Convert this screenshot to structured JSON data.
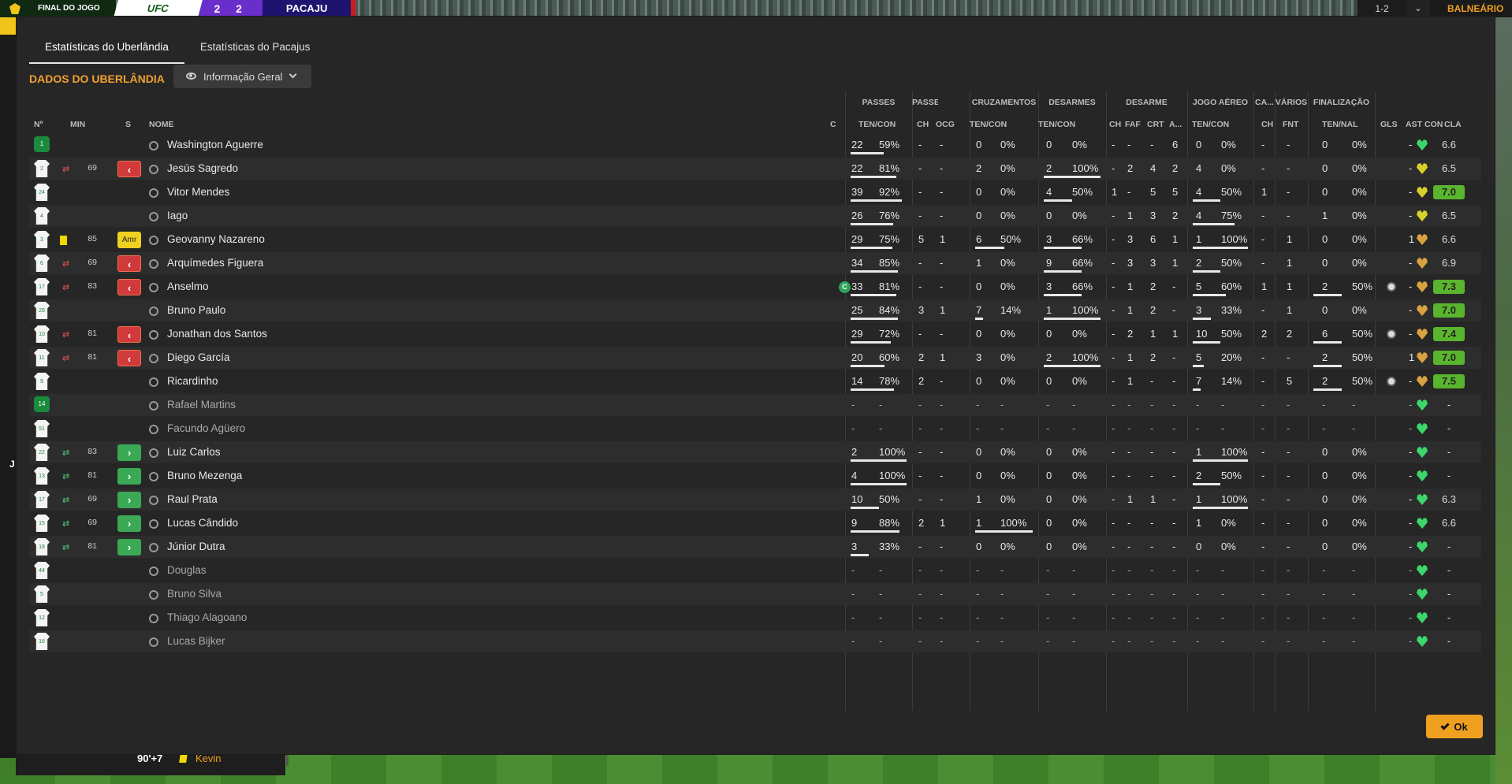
{
  "topbar": {
    "state": "FINAL DO JOGO",
    "home": "UFC",
    "score": "2 2",
    "away": "PACAJU",
    "period": "1-2",
    "dressing": "BALNEÁRIO"
  },
  "left_letter": "J",
  "event": {
    "minute": "90'+7",
    "player": "Kevin"
  },
  "tabs": [
    "Estatísticas do Uberlândia",
    "Estatísticas do Pacajus"
  ],
  "section_title": "DADOS DO UBERLÂNDIA",
  "view_select": "Informação Geral",
  "groups": [
    "PASSES",
    "PASSE",
    "CRUZAMENTOS",
    "DESARMES",
    "DESARME",
    "JOGO AÉREO",
    "CA...",
    "VÁRIOS",
    "FINALIZAÇÃO"
  ],
  "headers": [
    "Nº",
    "MIN",
    "S",
    "NOME",
    "C",
    "TEN/CON",
    "CH",
    "OCG",
    "TEN/CON",
    "TEN/CON",
    "CH",
    "FAF",
    "CRT",
    "A...",
    "TEN/CON",
    "CH",
    "FNT",
    "TEN/NAL",
    "GLS",
    "AST",
    "CON",
    "CLA"
  ],
  "players": [
    {
      "no": "1",
      "gk": true,
      "name": "Washington Aguerre",
      "pas": [
        "22",
        "59%"
      ],
      "pch": "-",
      "pocg": "-",
      "cr": [
        "0",
        "0%"
      ],
      "ds": [
        "0",
        "0%"
      ],
      "dc": "-",
      "faf": "-",
      "crt": "-",
      "a": "6",
      "aer": [
        "0",
        "0%"
      ],
      "cach": "-",
      "fnt": "-",
      "fin": [
        "0",
        "0%"
      ],
      "gls": "",
      "ast": "-",
      "con": "green",
      "cla": "6.6",
      "hi": false
    },
    {
      "no": "2",
      "min": "69",
      "sub": "out",
      "name": "Jesús Sagredo",
      "pas": [
        "22",
        "81%"
      ],
      "pch": "-",
      "pocg": "-",
      "cr": [
        "2",
        "0%"
      ],
      "ds": [
        "2",
        "100%"
      ],
      "dc": "-",
      "faf": "2",
      "crt": "4",
      "a": "2",
      "aer": [
        "4",
        "0%"
      ],
      "cach": "-",
      "fnt": "-",
      "fin": [
        "0",
        "0%"
      ],
      "gls": "",
      "ast": "-",
      "con": "yellow",
      "cla": "6.5",
      "hi": false
    },
    {
      "no": "24",
      "name": "Vitor Mendes",
      "pas": [
        "39",
        "92%"
      ],
      "pch": "-",
      "pocg": "-",
      "cr": [
        "0",
        "0%"
      ],
      "ds": [
        "4",
        "50%"
      ],
      "dc": "1",
      "faf": "-",
      "crt": "5",
      "a": "5",
      "aer": [
        "4",
        "50%"
      ],
      "cach": "1",
      "fnt": "-",
      "fin": [
        "0",
        "0%"
      ],
      "gls": "",
      "ast": "-",
      "con": "yellow",
      "cla": "7.0",
      "hi": true
    },
    {
      "no": "4",
      "name": "Iago",
      "pas": [
        "26",
        "76%"
      ],
      "pch": "-",
      "pocg": "-",
      "cr": [
        "0",
        "0%"
      ],
      "ds": [
        "0",
        "0%"
      ],
      "dc": "-",
      "faf": "1",
      "crt": "3",
      "a": "2",
      "aer": [
        "4",
        "75%"
      ],
      "cach": "-",
      "fnt": "-",
      "fin": [
        "1",
        "0%"
      ],
      "gls": "",
      "ast": "-",
      "con": "yellow",
      "cla": "6.5",
      "hi": false
    },
    {
      "no": "3",
      "min": "85",
      "sub": "amr",
      "subtext": "Amr",
      "yellow": true,
      "name": "Geovanny Nazareno",
      "pas": [
        "29",
        "75%"
      ],
      "pch": "5",
      "pocg": "1",
      "cr": [
        "6",
        "50%"
      ],
      "ds": [
        "3",
        "66%"
      ],
      "dc": "-",
      "faf": "3",
      "crt": "6",
      "a": "1",
      "aer": [
        "1",
        "100%"
      ],
      "cach": "-",
      "fnt": "1",
      "fin": [
        "0",
        "0%"
      ],
      "gls": "",
      "ast": "1",
      "con": "orange",
      "cla": "6.6",
      "hi": false
    },
    {
      "no": "6",
      "min": "69",
      "sub": "out",
      "name": "Arquímedes Figuera",
      "pas": [
        "34",
        "85%"
      ],
      "pch": "-",
      "pocg": "-",
      "cr": [
        "1",
        "0%"
      ],
      "ds": [
        "9",
        "66%"
      ],
      "dc": "-",
      "faf": "3",
      "crt": "3",
      "a": "1",
      "aer": [
        "2",
        "50%"
      ],
      "cach": "-",
      "fnt": "1",
      "fin": [
        "0",
        "0%"
      ],
      "gls": "",
      "ast": "-",
      "con": "orange",
      "cla": "6.9",
      "hi": false
    },
    {
      "no": "17",
      "min": "83",
      "sub": "out",
      "captain": true,
      "name": "Anselmo",
      "pas": [
        "33",
        "81%"
      ],
      "pch": "-",
      "pocg": "-",
      "cr": [
        "0",
        "0%"
      ],
      "ds": [
        "3",
        "66%"
      ],
      "dc": "-",
      "faf": "1",
      "crt": "2",
      "a": "-",
      "aer": [
        "5",
        "60%"
      ],
      "cach": "1",
      "fnt": "1",
      "fin": [
        "2",
        "50%"
      ],
      "gls": "ball",
      "ast": "-",
      "con": "orange",
      "cla": "7.3",
      "hi": true
    },
    {
      "no": "29",
      "name": "Bruno Paulo",
      "pas": [
        "25",
        "84%"
      ],
      "pch": "3",
      "pocg": "1",
      "cr": [
        "7",
        "14%"
      ],
      "ds": [
        "1",
        "100%"
      ],
      "dc": "-",
      "faf": "1",
      "crt": "2",
      "a": "-",
      "aer": [
        "3",
        "33%"
      ],
      "cach": "-",
      "fnt": "1",
      "fin": [
        "0",
        "0%"
      ],
      "gls": "",
      "ast": "-",
      "con": "orange",
      "cla": "7.0",
      "hi": true
    },
    {
      "no": "10",
      "min": "81",
      "sub": "out",
      "name": "Jonathan dos Santos",
      "pas": [
        "29",
        "72%"
      ],
      "pch": "-",
      "pocg": "-",
      "cr": [
        "0",
        "0%"
      ],
      "ds": [
        "0",
        "0%"
      ],
      "dc": "-",
      "faf": "2",
      "crt": "1",
      "a": "1",
      "aer": [
        "10",
        "50%"
      ],
      "cach": "2",
      "fnt": "2",
      "fin": [
        "6",
        "50%"
      ],
      "gls": "ball",
      "ast": "-",
      "con": "orange",
      "cla": "7.4",
      "hi": true
    },
    {
      "no": "11",
      "min": "81",
      "sub": "out",
      "name": "Diego García",
      "pas": [
        "20",
        "60%"
      ],
      "pch": "2",
      "pocg": "1",
      "cr": [
        "3",
        "0%"
      ],
      "ds": [
        "2",
        "100%"
      ],
      "dc": "-",
      "faf": "1",
      "crt": "2",
      "a": "-",
      "aer": [
        "5",
        "20%"
      ],
      "cach": "-",
      "fnt": "-",
      "fin": [
        "2",
        "50%"
      ],
      "gls": "",
      "ast": "1",
      "con": "orange",
      "cla": "7.0",
      "hi": true
    },
    {
      "no": "9",
      "name": "Ricardinho",
      "pas": [
        "14",
        "78%"
      ],
      "pch": "2",
      "pocg": "-",
      "cr": [
        "0",
        "0%"
      ],
      "ds": [
        "0",
        "0%"
      ],
      "dc": "-",
      "faf": "1",
      "crt": "-",
      "a": "-",
      "aer": [
        "7",
        "14%"
      ],
      "cach": "-",
      "fnt": "5",
      "fin": [
        "2",
        "50%"
      ],
      "gls": "ball",
      "ast": "-",
      "con": "orange",
      "cla": "7.5",
      "hi": true
    },
    {
      "no": "14",
      "gk": true,
      "dim": true,
      "name": "Rafael Martins",
      "pas": [
        "-",
        "-"
      ],
      "pch": "-",
      "pocg": "-",
      "cr": [
        "-",
        "-"
      ],
      "ds": [
        "-",
        "-"
      ],
      "dc": "-",
      "faf": "-",
      "crt": "-",
      "a": "-",
      "aer": [
        "-",
        "-"
      ],
      "cach": "-",
      "fnt": "-",
      "fin": [
        "-",
        "-"
      ],
      "gls": "",
      "ast": "-",
      "con": "green",
      "cla": "-",
      "hi": false
    },
    {
      "no": "51",
      "dim": true,
      "name": "Facundo Agüero",
      "pas": [
        "-",
        "-"
      ],
      "pch": "-",
      "pocg": "-",
      "cr": [
        "-",
        "-"
      ],
      "ds": [
        "-",
        "-"
      ],
      "dc": "-",
      "faf": "-",
      "crt": "-",
      "a": "-",
      "aer": [
        "-",
        "-"
      ],
      "cach": "-",
      "fnt": "-",
      "fin": [
        "-",
        "-"
      ],
      "gls": "",
      "ast": "-",
      "con": "green",
      "cla": "-",
      "hi": false
    },
    {
      "no": "22",
      "min": "83",
      "sub": "in",
      "name": "Luiz Carlos",
      "pas": [
        "2",
        "100%"
      ],
      "pch": "-",
      "pocg": "-",
      "cr": [
        "0",
        "0%"
      ],
      "ds": [
        "0",
        "0%"
      ],
      "dc": "-",
      "faf": "-",
      "crt": "-",
      "a": "-",
      "aer": [
        "1",
        "100%"
      ],
      "cach": "-",
      "fnt": "-",
      "fin": [
        "0",
        "0%"
      ],
      "gls": "",
      "ast": "-",
      "con": "green",
      "cla": "-",
      "hi": false
    },
    {
      "no": "13",
      "min": "81",
      "sub": "in",
      "name": "Bruno Mezenga",
      "pas": [
        "4",
        "100%"
      ],
      "pch": "-",
      "pocg": "-",
      "cr": [
        "0",
        "0%"
      ],
      "ds": [
        "0",
        "0%"
      ],
      "dc": "-",
      "faf": "-",
      "crt": "-",
      "a": "-",
      "aer": [
        "2",
        "50%"
      ],
      "cach": "-",
      "fnt": "-",
      "fin": [
        "0",
        "0%"
      ],
      "gls": "",
      "ast": "-",
      "con": "green",
      "cla": "-",
      "hi": false
    },
    {
      "no": "17",
      "min": "69",
      "sub": "in",
      "name": "Raul Prata",
      "pas": [
        "10",
        "50%"
      ],
      "pch": "-",
      "pocg": "-",
      "cr": [
        "1",
        "0%"
      ],
      "ds": [
        "0",
        "0%"
      ],
      "dc": "-",
      "faf": "1",
      "crt": "1",
      "a": "-",
      "aer": [
        "1",
        "100%"
      ],
      "cach": "-",
      "fnt": "-",
      "fin": [
        "0",
        "0%"
      ],
      "gls": "",
      "ast": "-",
      "con": "green",
      "cla": "6.3",
      "hi": false
    },
    {
      "no": "15",
      "min": "69",
      "sub": "in",
      "name": "Lucas Cândido",
      "pas": [
        "9",
        "88%"
      ],
      "pch": "2",
      "pocg": "1",
      "cr": [
        "1",
        "100%"
      ],
      "ds": [
        "0",
        "0%"
      ],
      "dc": "-",
      "faf": "-",
      "crt": "-",
      "a": "-",
      "aer": [
        "1",
        "0%"
      ],
      "cach": "-",
      "fnt": "-",
      "fin": [
        "0",
        "0%"
      ],
      "gls": "",
      "ast": "-",
      "con": "green",
      "cla": "6.6",
      "hi": false
    },
    {
      "no": "18",
      "min": "81",
      "sub": "in",
      "name": "Júnior Dutra",
      "pas": [
        "3",
        "33%"
      ],
      "pch": "-",
      "pocg": "-",
      "cr": [
        "0",
        "0%"
      ],
      "ds": [
        "0",
        "0%"
      ],
      "dc": "-",
      "faf": "-",
      "crt": "-",
      "a": "-",
      "aer": [
        "0",
        "0%"
      ],
      "cach": "-",
      "fnt": "-",
      "fin": [
        "0",
        "0%"
      ],
      "gls": "",
      "ast": "-",
      "con": "green",
      "cla": "-",
      "hi": false
    },
    {
      "no": "44",
      "dim": true,
      "name": "Douglas",
      "pas": [
        "-",
        "-"
      ],
      "pch": "-",
      "pocg": "-",
      "cr": [
        "-",
        "-"
      ],
      "ds": [
        "-",
        "-"
      ],
      "dc": "-",
      "faf": "-",
      "crt": "-",
      "a": "-",
      "aer": [
        "-",
        "-"
      ],
      "cach": "-",
      "fnt": "-",
      "fin": [
        "-",
        "-"
      ],
      "gls": "",
      "ast": "-",
      "con": "green",
      "cla": "-",
      "hi": false
    },
    {
      "no": "5",
      "dim": true,
      "name": "Bruno Silva",
      "pas": [
        "-",
        "-"
      ],
      "pch": "-",
      "pocg": "-",
      "cr": [
        "-",
        "-"
      ],
      "ds": [
        "-",
        "-"
      ],
      "dc": "-",
      "faf": "-",
      "crt": "-",
      "a": "-",
      "aer": [
        "-",
        "-"
      ],
      "cach": "-",
      "fnt": "-",
      "fin": [
        "-",
        "-"
      ],
      "gls": "",
      "ast": "-",
      "con": "green",
      "cla": "-",
      "hi": false
    },
    {
      "no": "12",
      "dim": true,
      "name": "Thiago Alagoano",
      "pas": [
        "-",
        "-"
      ],
      "pch": "-",
      "pocg": "-",
      "cr": [
        "-",
        "-"
      ],
      "ds": [
        "-",
        "-"
      ],
      "dc": "-",
      "faf": "-",
      "crt": "-",
      "a": "-",
      "aer": [
        "-",
        "-"
      ],
      "cach": "-",
      "fnt": "-",
      "fin": [
        "-",
        "-"
      ],
      "gls": "",
      "ast": "-",
      "con": "green",
      "cla": "-",
      "hi": false
    },
    {
      "no": "16",
      "dim": true,
      "name": "Lucas Bijker",
      "pas": [
        "-",
        "-"
      ],
      "pch": "-",
      "pocg": "-",
      "cr": [
        "-",
        "-"
      ],
      "ds": [
        "-",
        "-"
      ],
      "dc": "-",
      "faf": "-",
      "crt": "-",
      "a": "-",
      "aer": [
        "-",
        "-"
      ],
      "cach": "-",
      "fnt": "-",
      "fin": [
        "-",
        "-"
      ],
      "gls": "",
      "ast": "-",
      "con": "green",
      "cla": "-",
      "hi": false
    }
  ],
  "ok_label": "Ok",
  "colors": {
    "accent": "#f0a020",
    "title": "#f0a030",
    "rating_high": "#5ab52e",
    "sub_out": "#d03a3a",
    "sub_in": "#3aa855"
  }
}
